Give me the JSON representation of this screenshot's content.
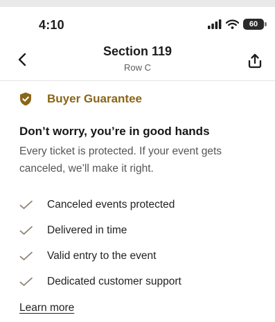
{
  "status_bar": {
    "time": "4:10",
    "battery": "60",
    "icons": [
      "signal-icon",
      "wifi-icon",
      "battery-icon"
    ]
  },
  "header": {
    "title": "Section 119",
    "subtitle": "Row C",
    "back_icon": "chevron-left-icon",
    "share_icon": "share-icon"
  },
  "guarantee": {
    "icon": "shield-check-icon",
    "title": "Buyer Guarantee",
    "headline": "Don’t worry, you’re in good hands",
    "description": "Every ticket is protected. If your event gets canceled, we’ll make it right.",
    "features": [
      "Canceled events protected",
      "Delivered in time",
      "Valid entry to the event",
      "Dedicated customer support"
    ],
    "learn_more": "Learn more"
  },
  "colors": {
    "accent": "#8b6517",
    "text": "#161616",
    "muted": "#555555"
  }
}
